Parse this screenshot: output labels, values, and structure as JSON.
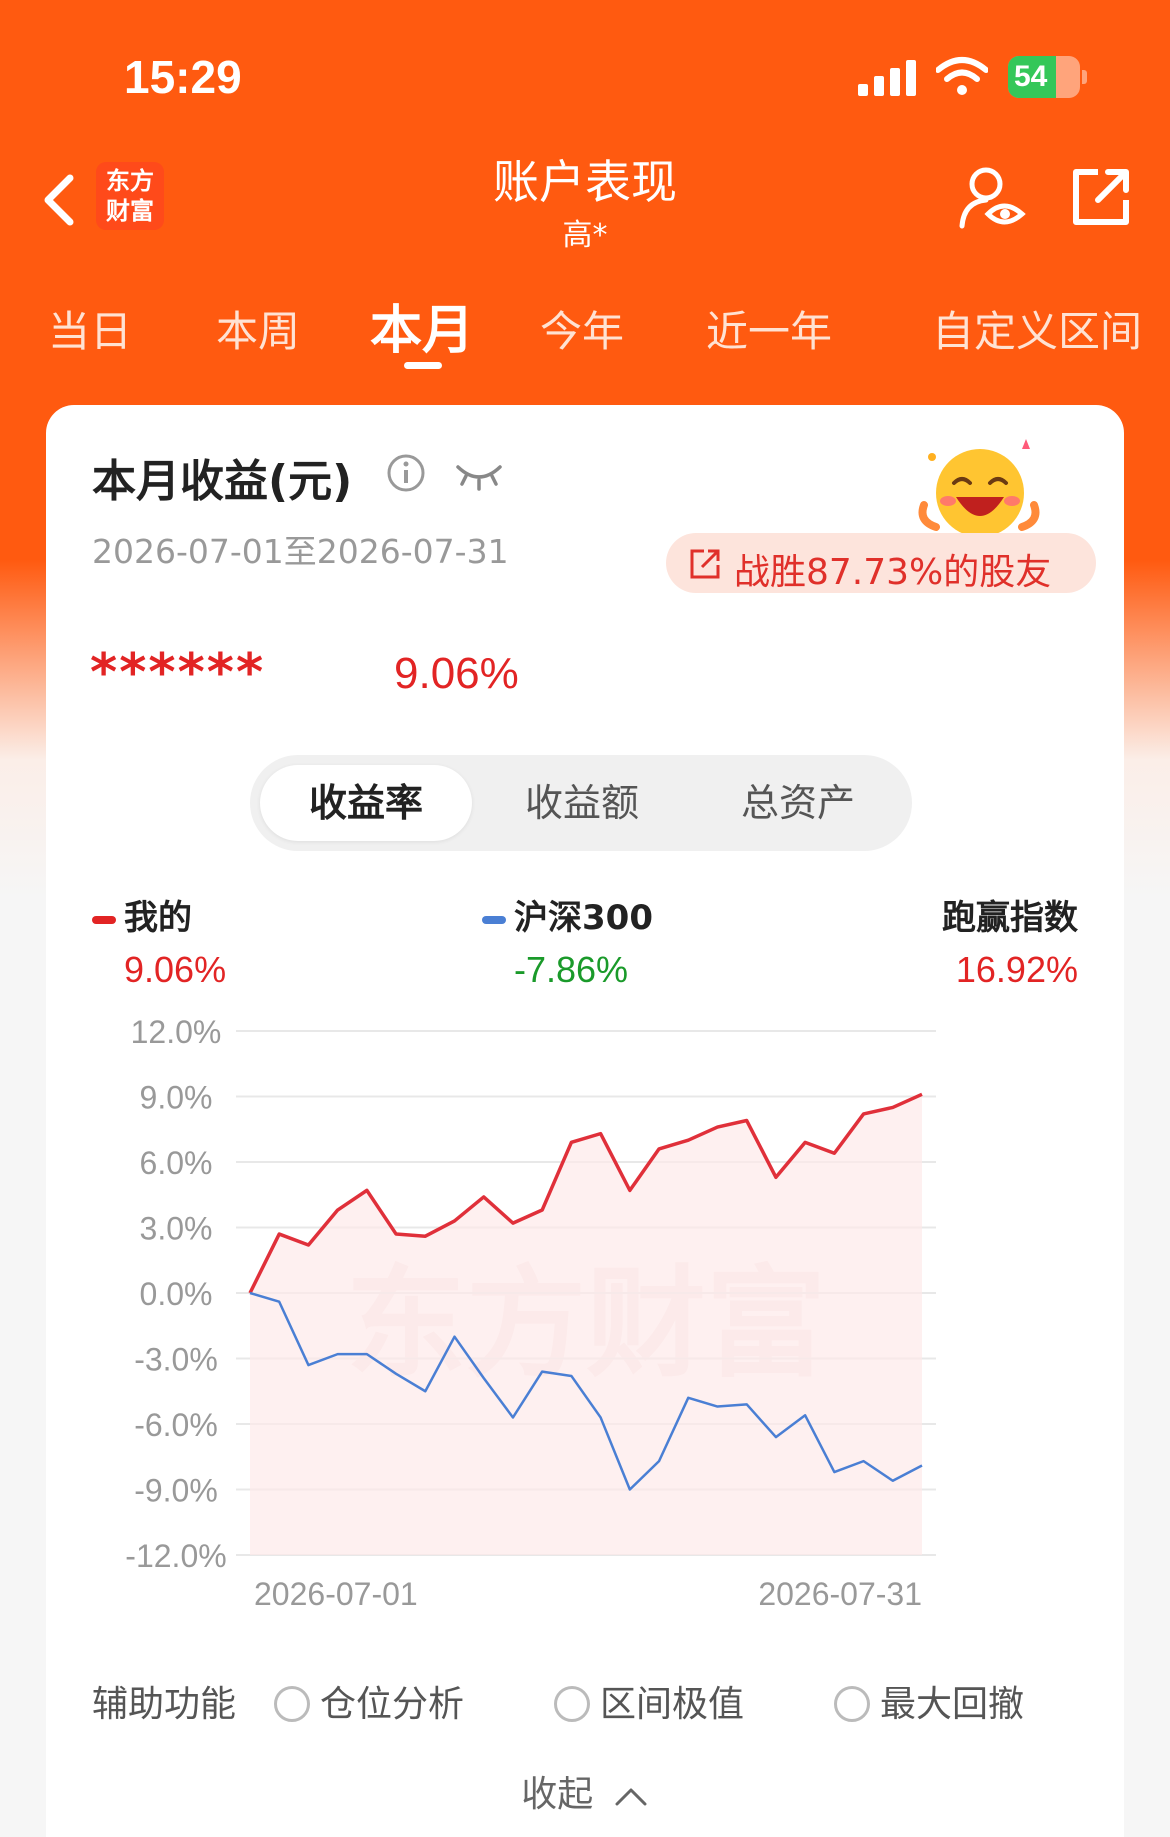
{
  "status_bar": {
    "time": "15:29",
    "battery": "54"
  },
  "header": {
    "title": "账户表现",
    "subtitle": "高*",
    "logo_text": "东方\n财富"
  },
  "period_tabs": [
    "当日",
    "本周",
    "本月",
    "今年",
    "近一年",
    "自定义区间"
  ],
  "summary": {
    "title": "本月收益(元)",
    "date_range": "2026-07-01至2026-07-31",
    "beat_text": "战胜87.73%的股友",
    "masked_amount": "******",
    "return_pct": "9.06%"
  },
  "segments": [
    "收益率",
    "收益额",
    "总资产"
  ],
  "legend": [
    {
      "name": "我的",
      "value": "9.06%",
      "color": "#e22424"
    },
    {
      "name": "沪深300",
      "value": "-7.86%",
      "color": "#1a9a2a"
    },
    {
      "name": "跑赢指数",
      "value": "16.92%",
      "color": "#e22424"
    }
  ],
  "watermark": "东方财富",
  "aux": {
    "label": "辅助功能",
    "options": [
      "仓位分析",
      "区间极值",
      "最大回撤"
    ]
  },
  "collapse_label": "收起",
  "chart_data": {
    "type": "line",
    "ylim": [
      -12,
      12
    ],
    "y_ticks": [
      "12.0%",
      "9.0%",
      "6.0%",
      "3.0%",
      "0.0%",
      "-3.0%",
      "-6.0%",
      "-9.0%",
      "-12.0%"
    ],
    "x_tick_labels": [
      "2026-07-01",
      "2026-07-31"
    ],
    "series": [
      {
        "name": "我的",
        "color": "#e0303a",
        "values": [
          0,
          2.7,
          2.2,
          3.8,
          4.7,
          2.7,
          2.6,
          3.3,
          4.4,
          3.2,
          3.8,
          6.9,
          7.3,
          4.7,
          6.6,
          7.0,
          7.6,
          7.9,
          5.3,
          6.9,
          6.4,
          8.2,
          8.5,
          9.1
        ]
      },
      {
        "name": "沪深300",
        "color": "#4a7fd4",
        "values": [
          0,
          -0.4,
          -3.3,
          -2.8,
          -2.8,
          -3.7,
          -4.5,
          -2.0,
          -3.9,
          -5.7,
          -3.6,
          -3.8,
          -5.7,
          -9.0,
          -7.7,
          -4.8,
          -5.2,
          -5.1,
          -6.6,
          -5.6,
          -8.2,
          -7.7,
          -8.6,
          -7.9
        ]
      }
    ]
  }
}
